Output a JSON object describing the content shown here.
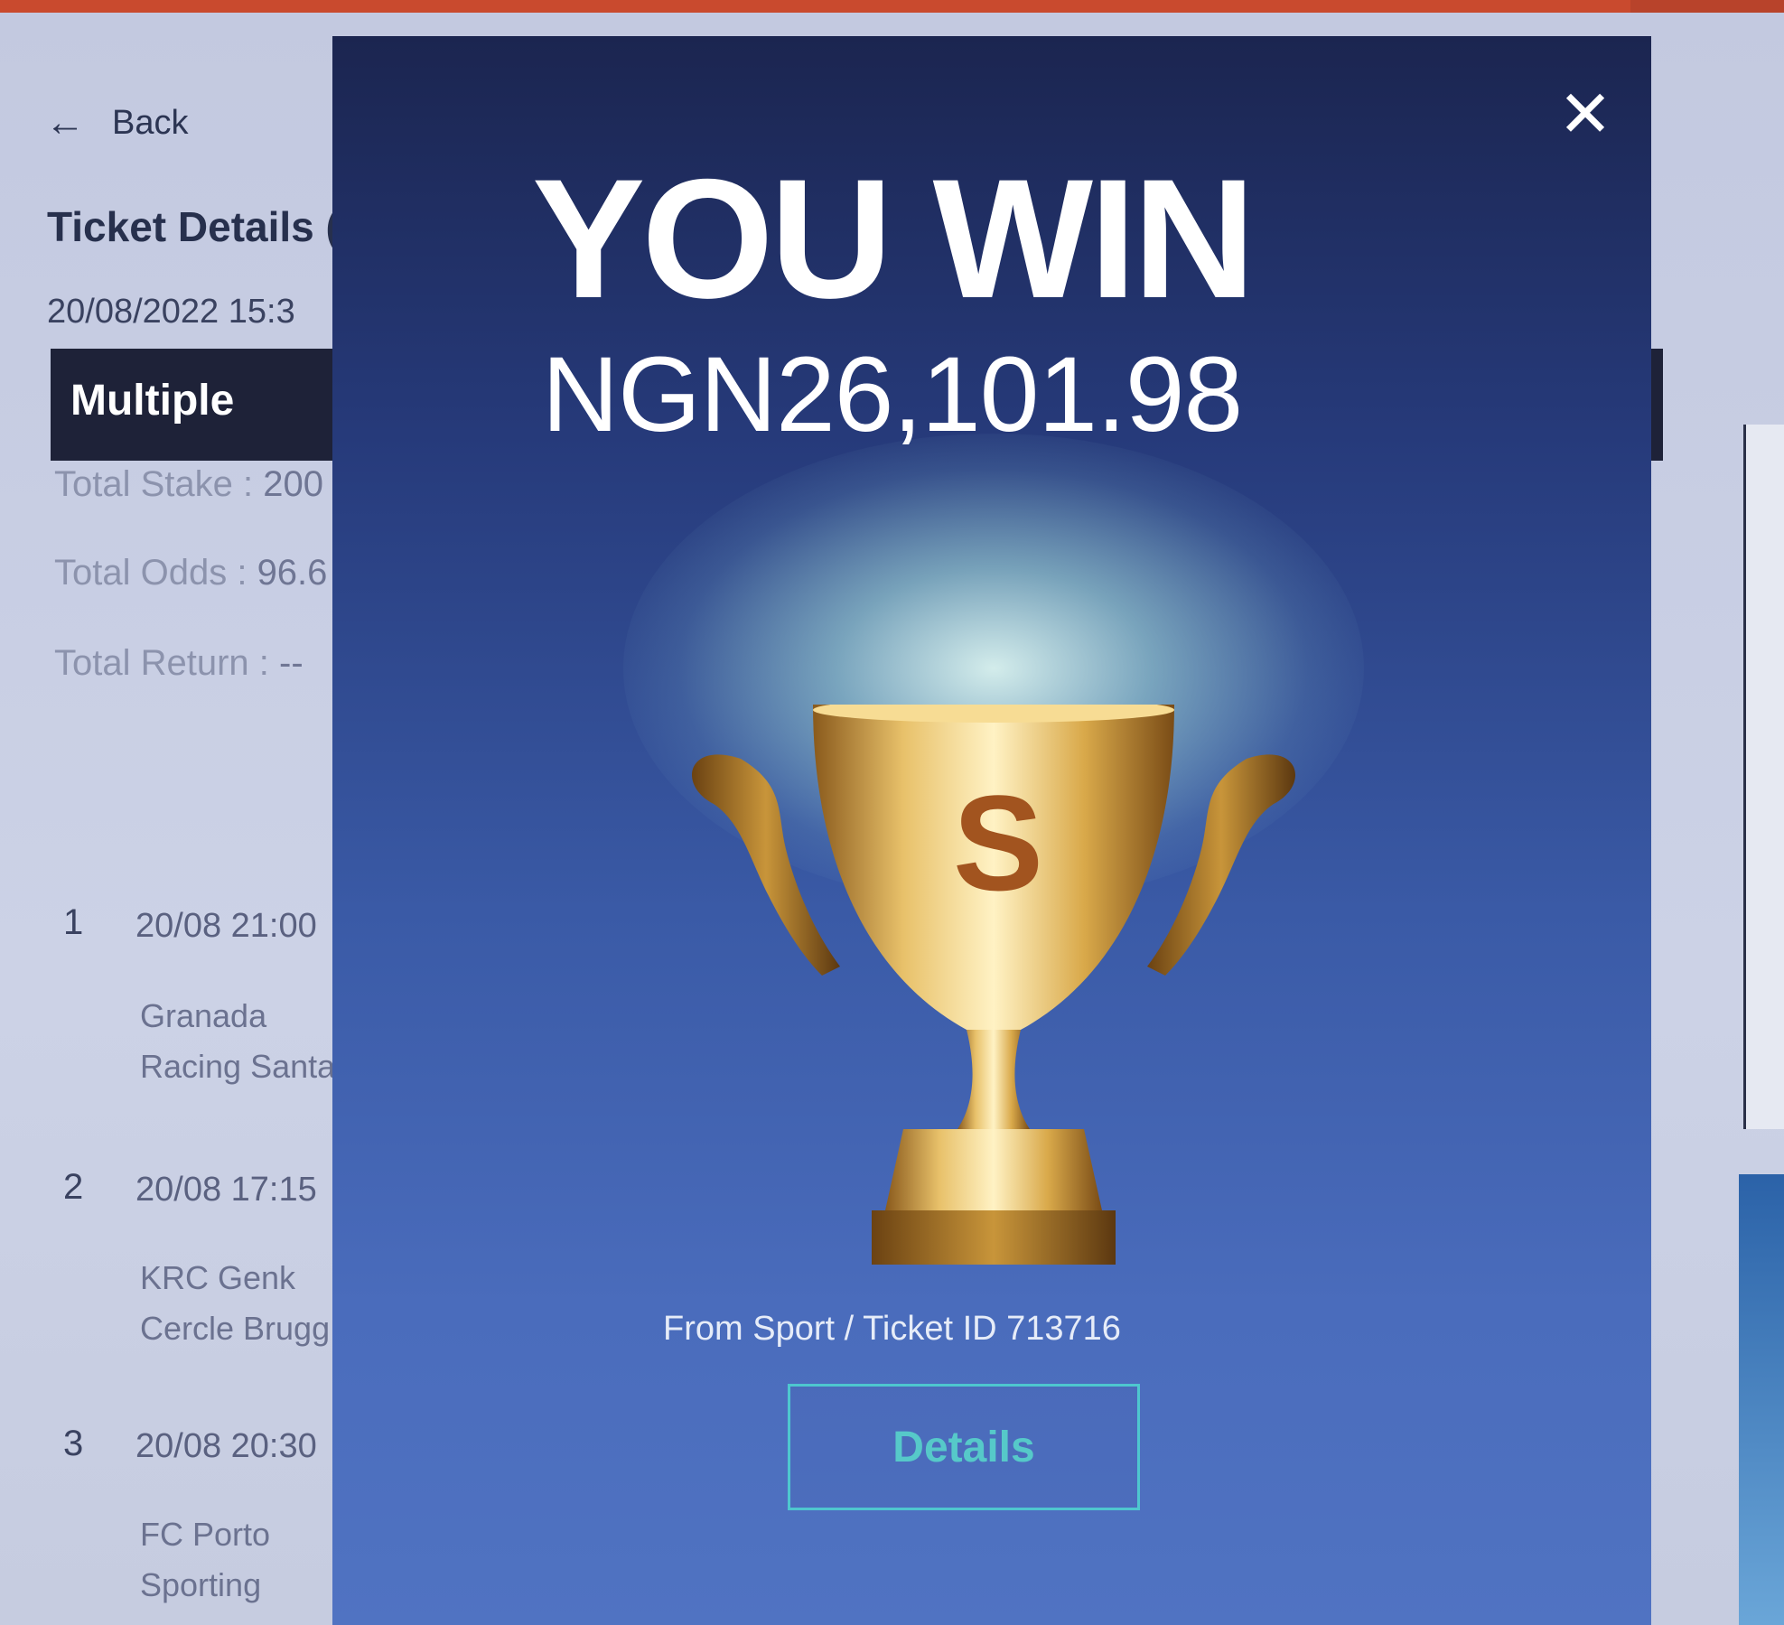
{
  "background_page": {
    "back_label": "Back",
    "ticket_title": "Ticket Details (I",
    "ticket_datetime": "20/08/2022 15:3",
    "bet_type": "Multiple",
    "total_stake_label": "Total Stake : ",
    "total_stake_value": "200",
    "total_odds_label": "Total Odds : ",
    "total_odds_value": "96.6",
    "total_return_label": "Total Return : ",
    "total_return_value": "--",
    "matches": [
      {
        "num": "1",
        "time": "20/08 21:00",
        "home": "Granada",
        "away": "Racing Santa"
      },
      {
        "num": "2",
        "time": "20/08 17:15",
        "home": "KRC Genk",
        "away": "Cercle Brugg"
      },
      {
        "num": "3",
        "time": "20/08 20:30",
        "home": "FC Porto",
        "away": "Sporting"
      }
    ]
  },
  "modal": {
    "headline": "YOU WIN",
    "amount": "NGN26,101.98",
    "source_text": "From Sport / Ticket ID 713716",
    "details_button": "Details",
    "close_icon": "close-icon",
    "trophy_icon": "trophy-icon",
    "trophy_letter": "S"
  },
  "colors": {
    "accent_teal": "#56c9c9",
    "win_status": "#2fae6a",
    "modal_top": "#1b2550",
    "modal_bottom": "#5073c2"
  }
}
